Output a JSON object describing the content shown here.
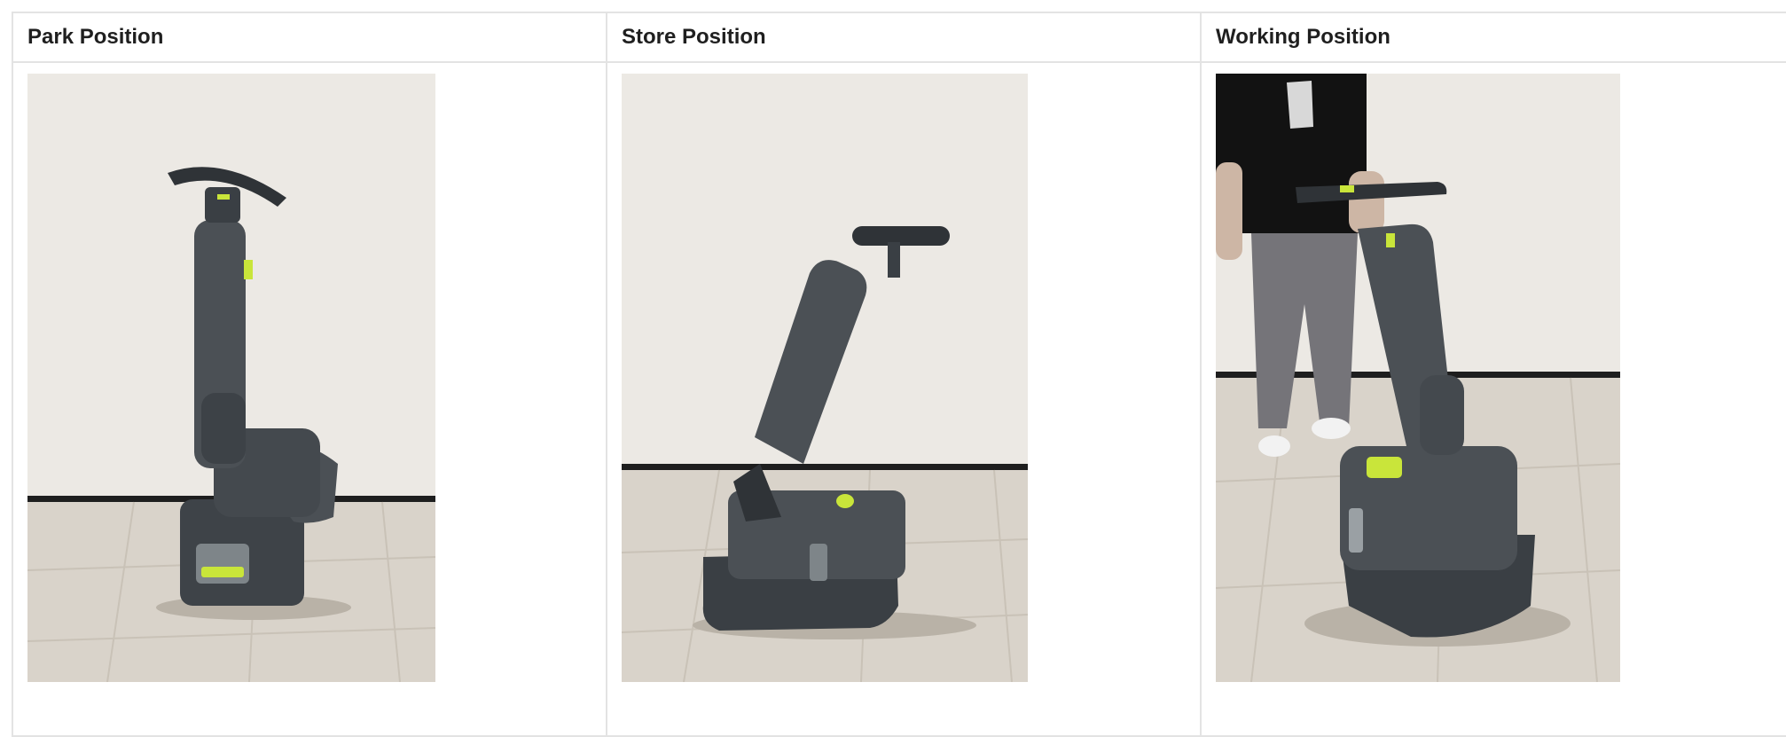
{
  "table": {
    "columns": [
      {
        "header": "Park Position",
        "image": "scrubber-park-position-photo"
      },
      {
        "header": "Store Position",
        "image": "scrubber-store-position-photo"
      },
      {
        "header": "Working Position",
        "image": "scrubber-working-position-photo"
      }
    ]
  },
  "colors": {
    "wall": "#ece9e4",
    "floor": "#d9d3ca",
    "machine": "#4b5055",
    "machine_dark": "#2f3337",
    "accent": "#c9e53a",
    "border": "#e3e3e3"
  }
}
